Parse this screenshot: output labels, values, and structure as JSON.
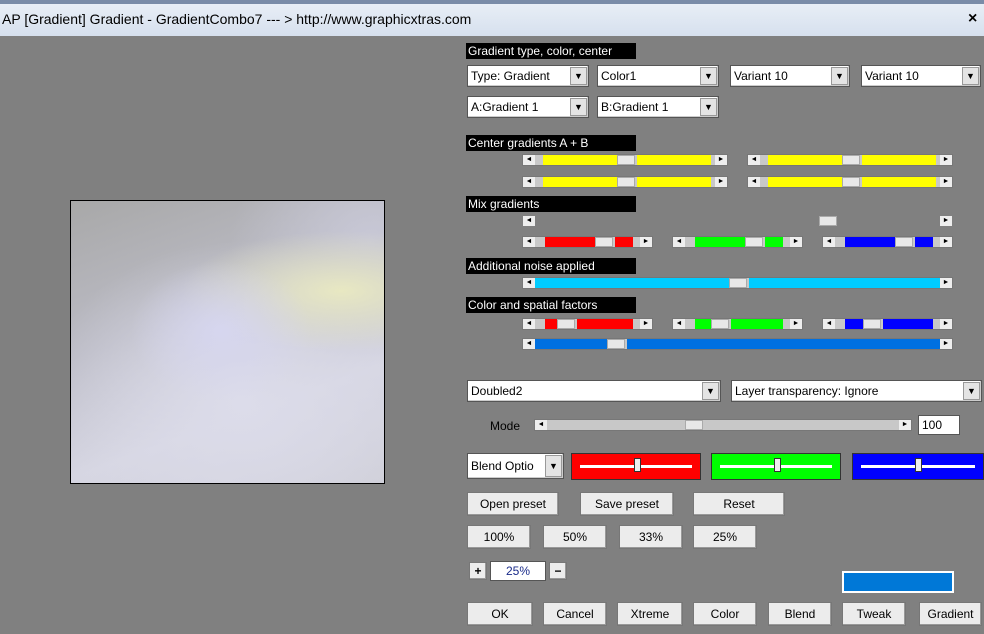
{
  "window": {
    "title": "AP [Gradient]  Gradient - GradientCombo7   --- > http://www.graphicxtras.com",
    "close_glyph": "×"
  },
  "sections": {
    "gradient_type": "Gradient type, color, center",
    "center": "Center gradients A + B",
    "mix": "Mix gradients",
    "noise": "Additional noise applied",
    "factors": "Color and spatial factors"
  },
  "combos": {
    "type": "Type: Gradient",
    "color": "Color1",
    "variant1": "Variant 10",
    "variant2": "Variant 10",
    "a": "A:Gradient 1",
    "b": "B:Gradient 1",
    "preset": "Doubled2",
    "layer": "Layer transparency: Ignore",
    "blend": "Blend Optio"
  },
  "mode": {
    "label": "Mode",
    "value": "100"
  },
  "buttons": {
    "open": "Open preset",
    "save": "Save preset",
    "reset": "Reset",
    "z100": "100%",
    "z50": "50%",
    "z33": "33%",
    "z25": "25%",
    "ok": "OK",
    "cancel": "Cancel",
    "xtreme": "Xtreme",
    "color": "Color",
    "blend": "Blend",
    "tweak": "Tweak",
    "gradient": "Gradient"
  },
  "zoom": {
    "plus": "+",
    "value": "25%",
    "minus": "−"
  },
  "colors": {
    "yellow": "#ffff00",
    "red": "#ff0000",
    "green": "#00ff00",
    "blue": "#0000ff",
    "cyan": "#00ccff",
    "azure": "#0070e0",
    "swatch": "#0078d7"
  },
  "arrow_glyphs": {
    "left": "◄",
    "right": "►",
    "down": "▼"
  }
}
